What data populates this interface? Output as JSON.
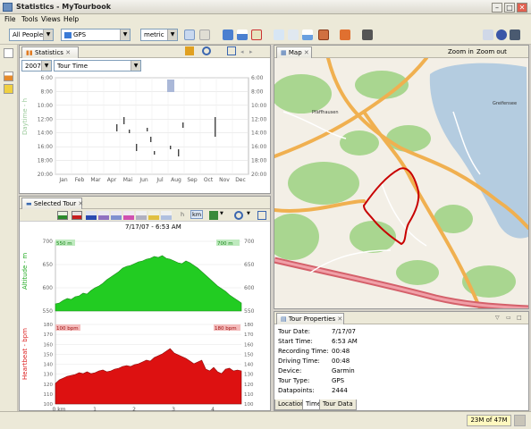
{
  "window": {
    "title": "Statistics - MyTourbook",
    "minimize": "–",
    "maximize": "□",
    "close": "✕"
  },
  "menu": [
    "File",
    "Tools",
    "Views",
    "Help"
  ],
  "toolbar": {
    "people": "All People",
    "device": "GPS",
    "units": "metric"
  },
  "statistics": {
    "tab": "Statistics",
    "year": "2007",
    "type": "Tour Time",
    "y_label": "Daytime - h",
    "y_ticks": [
      "6:00",
      "8:00",
      "10:00",
      "12:00",
      "14:00",
      "16:00",
      "18:00",
      "20:00"
    ],
    "months": [
      "Jan",
      "Feb",
      "Mar",
      "Apr",
      "Mai",
      "Jun",
      "Jul",
      "Aug",
      "Sep",
      "Oct",
      "Nov",
      "Dec"
    ]
  },
  "selected_tour": {
    "tab": "Selected Tour",
    "x_unit": "km",
    "chart_title": "7/17/07 - 6:53 AM",
    "x_ticks": [
      "0 km",
      "1",
      "2",
      "3",
      "4"
    ],
    "altitude": {
      "label": "Altitude - m",
      "ticks": [
        "700",
        "650",
        "600",
        "550"
      ],
      "min_badge": "550 m",
      "max_badge": "700 m",
      "color": "#22cc22"
    },
    "heartbeat": {
      "label": "Heartbeat - bpm",
      "ticks": [
        "180",
        "170",
        "160",
        "150",
        "140",
        "130",
        "120",
        "110",
        "100"
      ],
      "left_badge": "100 bpm",
      "right_badge": "180 bpm",
      "color": "#dd1111"
    }
  },
  "map": {
    "tab": "Map",
    "zoom_in": "Zoom in",
    "zoom_out": "Zoom out",
    "place_label": "Greifensee",
    "town_label": "Pfäffhausen"
  },
  "tour_properties": {
    "tab": "Tour Properties",
    "rows": [
      {
        "label": "Tour Date:",
        "value": "7/17/07"
      },
      {
        "label": "Start Time:",
        "value": "6:53 AM"
      },
      {
        "label": "Recording Time:",
        "value": "00:48"
      },
      {
        "label": "Driving Time:",
        "value": "00:48"
      },
      {
        "label": "Device:",
        "value": "Garmin"
      },
      {
        "label": "Tour Type:",
        "value": "GPS"
      },
      {
        "label": "Datapoints:",
        "value": "2444"
      }
    ],
    "bottom_tabs": [
      "Location",
      "Time",
      "Tour Data"
    ]
  },
  "status": {
    "memory": "23M of 47M"
  }
}
